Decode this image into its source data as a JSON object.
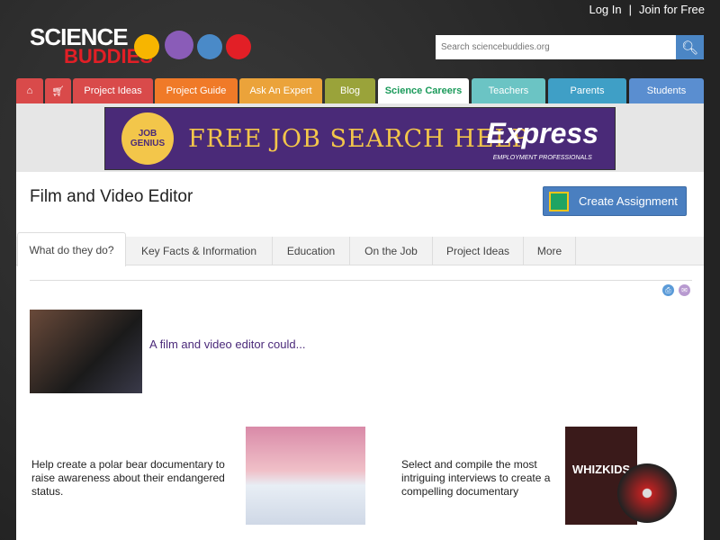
{
  "header": {
    "login": "Log In",
    "separator": "|",
    "join": "Join for Free",
    "logo_text_1": "SCIENCE",
    "logo_text_2": "BUDDIES",
    "search_placeholder": "Search sciencebuddies.org"
  },
  "nav": [
    {
      "label": "",
      "icon": "home-icon",
      "color": "#d94a4a"
    },
    {
      "label": "",
      "icon": "cart-icon",
      "color": "#d94a4a"
    },
    {
      "label": "Project Ideas",
      "color": "#d94a4a"
    },
    {
      "label": "Project Guide",
      "color": "#f07a28"
    },
    {
      "label": "Ask An Expert",
      "color": "#eba33a"
    },
    {
      "label": "Blog",
      "color": "#9aa33a"
    },
    {
      "label": "Science Careers",
      "color": "#ffffff",
      "active": true
    },
    {
      "label": "Teachers",
      "color": "#6bc4c4"
    },
    {
      "label": "Parents",
      "color": "#3f9fc6"
    },
    {
      "label": "Students",
      "color": "#5a8ed0"
    }
  ],
  "banner": {
    "badge": "JOB GENIUS",
    "headline": "FREE JOB SEARCH HELP",
    "brand": "Express",
    "brand_sub": "EMPLOYMENT PROFESSIONALS"
  },
  "page": {
    "title": "Film and Video Editor",
    "create_assignment": "Create Assignment"
  },
  "tabs": [
    "What do they do?",
    "Key Facts & Information",
    "Education",
    "On the Job",
    "Project Ideas",
    "More"
  ],
  "intro": "A film and video editor could...",
  "items": [
    {
      "text": "Help create a polar bear documentary to raise awareness about their endangered status."
    },
    {
      "text": "Select and compile the most intriguing interviews to create a compelling documentary",
      "image_text": "WHIZKIDS"
    }
  ]
}
